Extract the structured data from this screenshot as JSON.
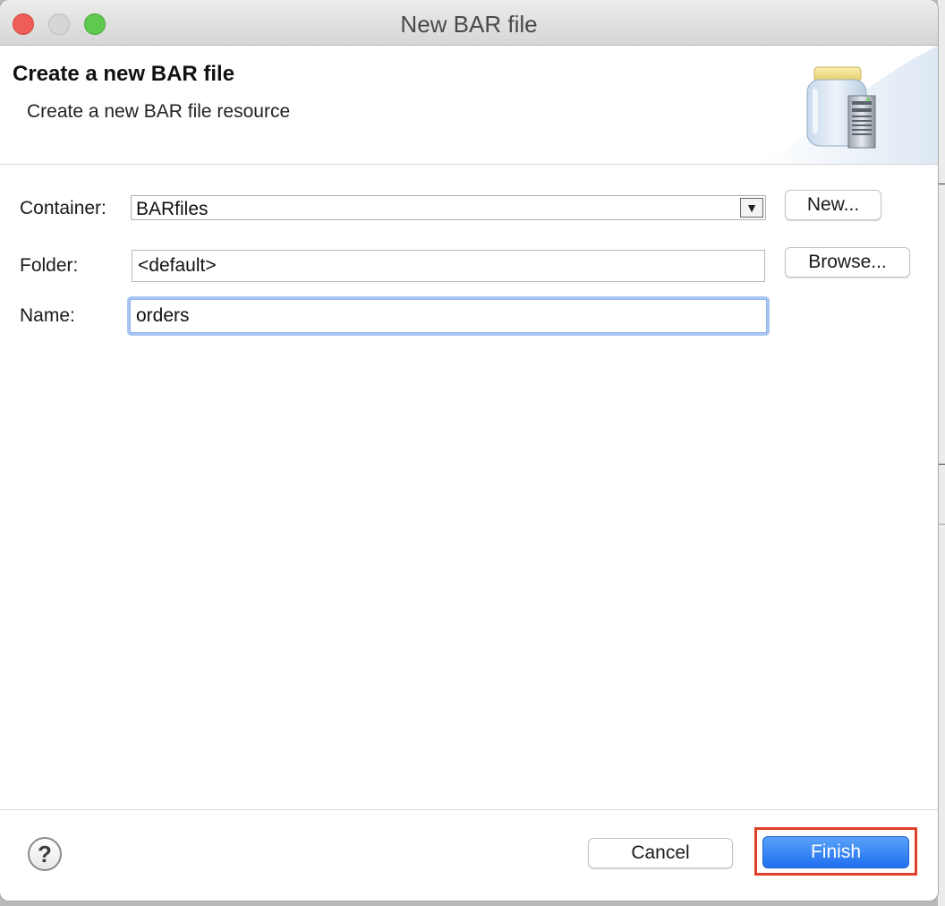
{
  "window": {
    "title": "New BAR file"
  },
  "header": {
    "title": "Create a new BAR file",
    "description": "Create a new BAR file resource",
    "icon": "bar-file-jar-icon"
  },
  "form": {
    "container": {
      "label": "Container:",
      "value": "BARfiles",
      "new_button": "New..."
    },
    "folder": {
      "label": "Folder:",
      "value": "<default>",
      "browse_button": "Browse..."
    },
    "name": {
      "label": "Name:",
      "value": "orders"
    }
  },
  "footer": {
    "help_icon": "?",
    "cancel_label": "Cancel",
    "finish_label": "Finish"
  },
  "colors": {
    "primary_button": "#1f6ff0",
    "highlight": "#e0412b",
    "focus_ring": "#a9c6f3"
  }
}
